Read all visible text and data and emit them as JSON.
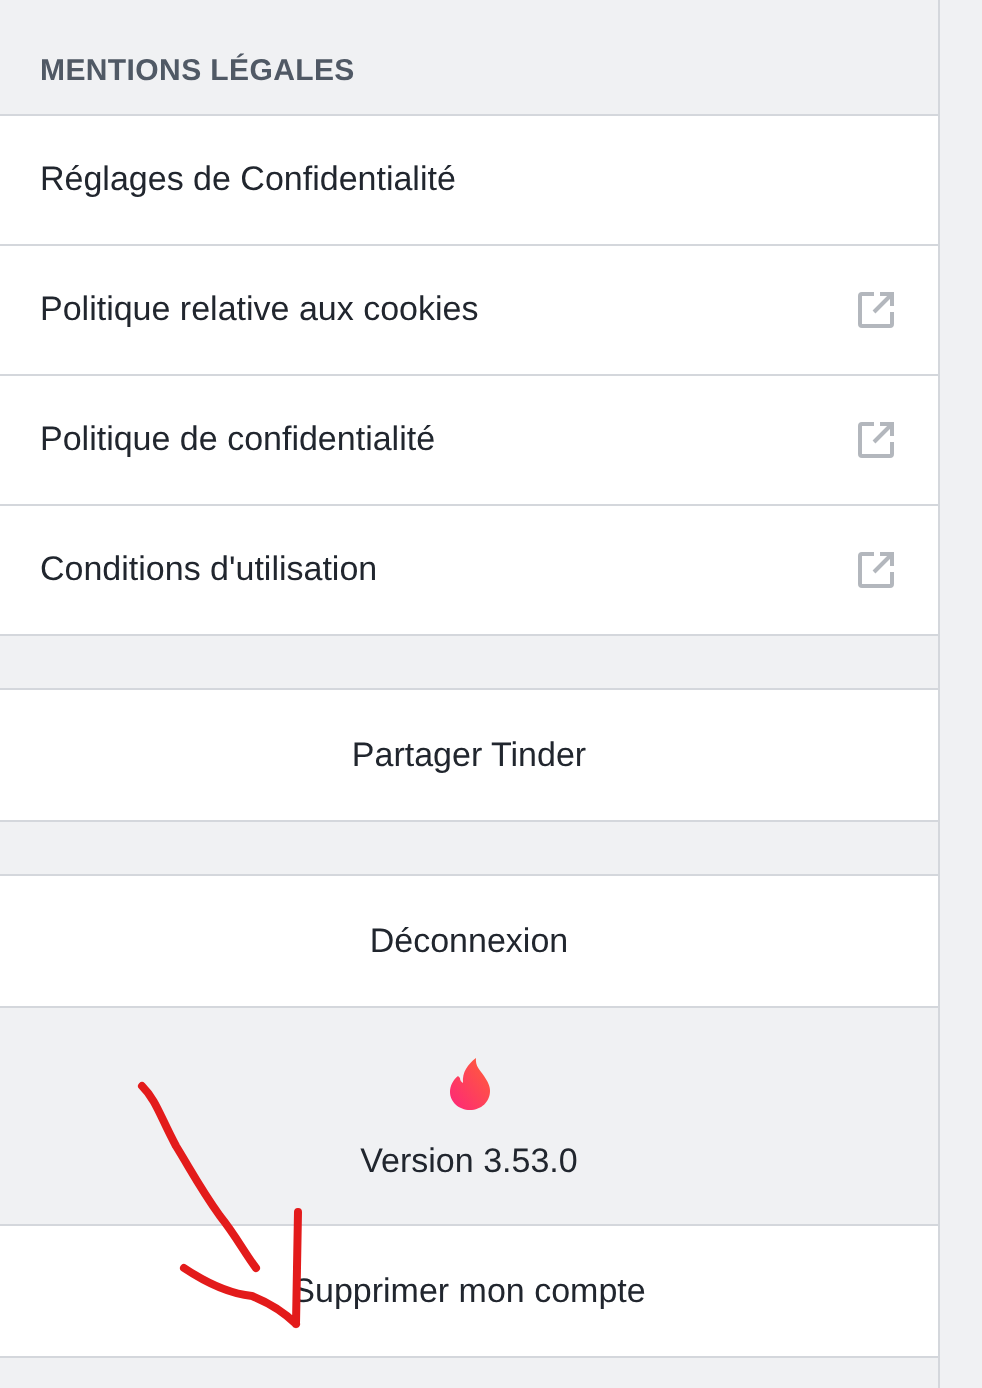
{
  "legal_section": {
    "heading": "MENTIONS LÉGALES",
    "items": [
      {
        "label": "Réglages de Confidentialité",
        "external": false
      },
      {
        "label": "Politique relative aux cookies",
        "external": true
      },
      {
        "label": "Politique de confidentialité",
        "external": true
      },
      {
        "label": "Conditions d'utilisation",
        "external": true
      }
    ]
  },
  "actions": [
    {
      "label": "Partager Tinder",
      "kind": "button"
    },
    {
      "label": "Déconnexion",
      "kind": "button"
    },
    {
      "label": "Version 3.53.0",
      "kind": "version"
    },
    {
      "label": "Supprimer mon compte",
      "kind": "button"
    }
  ]
}
